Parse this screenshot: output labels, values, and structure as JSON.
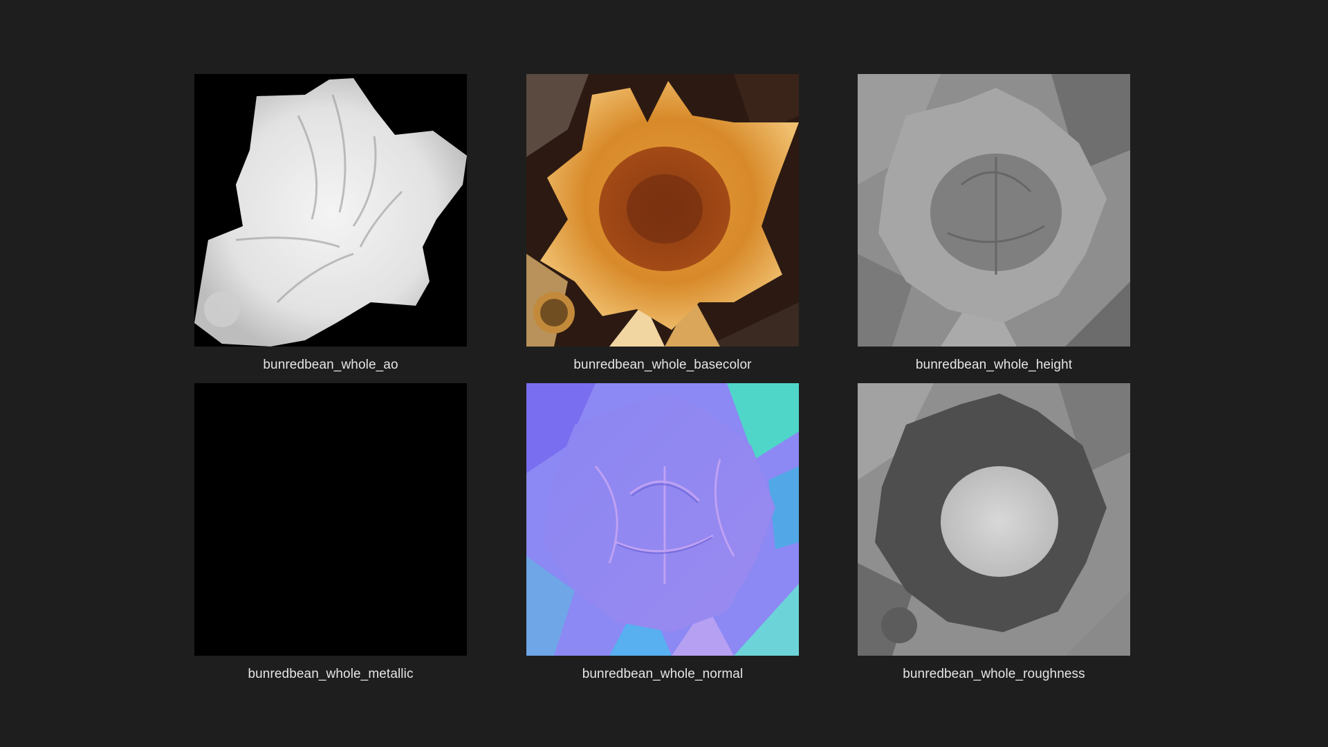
{
  "thumbnails": [
    {
      "label": "bunredbean_whole_ao",
      "icon": "ao-map-thumbnail"
    },
    {
      "label": "bunredbean_whole_basecolor",
      "icon": "basecolor-map-thumbnail"
    },
    {
      "label": "bunredbean_whole_height",
      "icon": "height-map-thumbnail"
    },
    {
      "label": "bunredbean_whole_metallic",
      "icon": "metallic-map-thumbnail"
    },
    {
      "label": "bunredbean_whole_normal",
      "icon": "normal-map-thumbnail"
    },
    {
      "label": "bunredbean_whole_roughness",
      "icon": "roughness-map-thumbnail"
    }
  ],
  "colors": {
    "background": "#1e1e1e",
    "caption": "#e6e6e6"
  }
}
